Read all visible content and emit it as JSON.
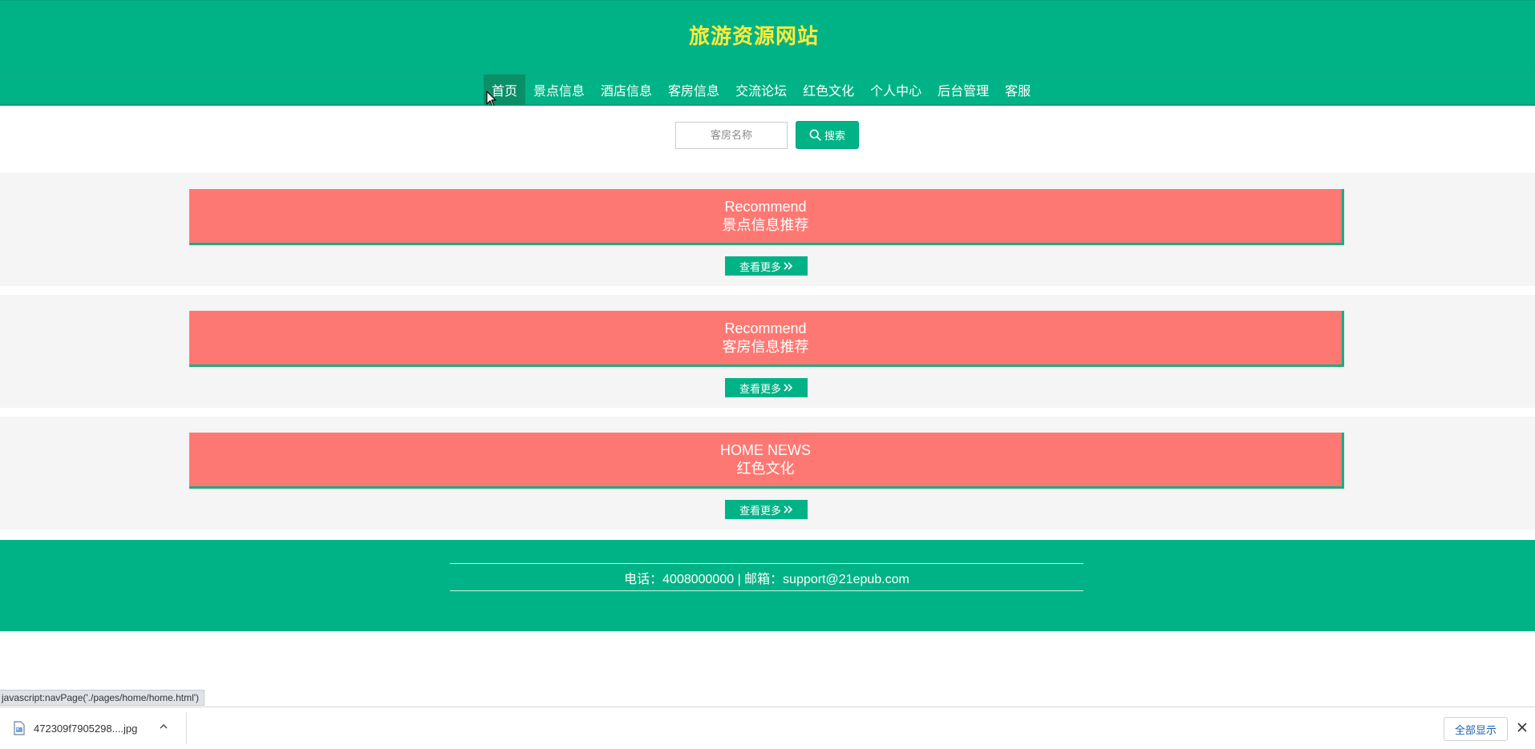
{
  "header": {
    "site_title": "旅游资源网站"
  },
  "nav": {
    "items": [
      {
        "label": "首页",
        "active": true
      },
      {
        "label": "景点信息"
      },
      {
        "label": "酒店信息"
      },
      {
        "label": "客房信息"
      },
      {
        "label": "交流论坛"
      },
      {
        "label": "红色文化"
      },
      {
        "label": "个人中心"
      },
      {
        "label": "后台管理"
      },
      {
        "label": "客服"
      }
    ]
  },
  "search": {
    "placeholder": "客房名称",
    "button_label": "搜索",
    "button_icon": "search-icon"
  },
  "sections": [
    {
      "title_en": "Recommend",
      "title_cn": "景点信息推荐",
      "more_label": "查看更多"
    },
    {
      "title_en": "Recommend",
      "title_cn": "客房信息推荐",
      "more_label": "查看更多"
    },
    {
      "title_en": "HOME NEWS",
      "title_cn": "红色文化",
      "more_label": "查看更多"
    }
  ],
  "footer": {
    "contact": "电话：4008000000 | 邮箱：support@21epub.com"
  },
  "browser": {
    "status_url": "javascript:navPage('./pages/home/home.html')",
    "download_filename": "472309f7905298....jpg",
    "show_all_label": "全部显示"
  },
  "colors": {
    "primary": "#00b386",
    "title": "#ffeb3b",
    "banner": "#fe7873",
    "nav_active": "#0b8f68"
  }
}
